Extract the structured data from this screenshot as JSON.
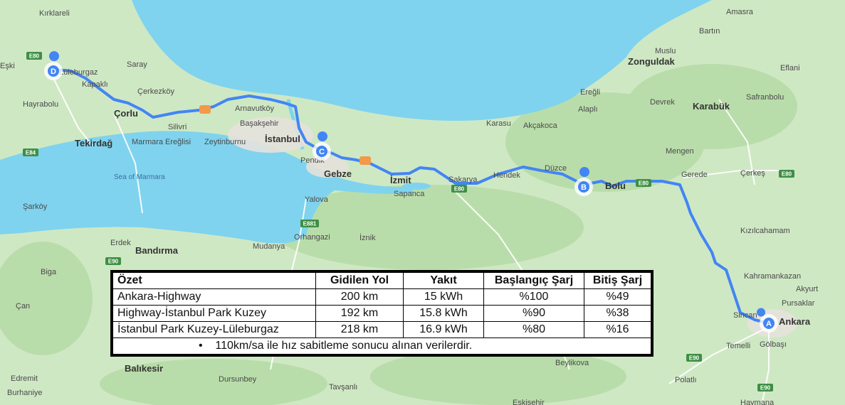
{
  "map": {
    "route_color": "#4285f4",
    "water_color": "#7fd3ee",
    "land_color": "#cfe8c4",
    "places": [
      "Kırklareli",
      "Lüleburgaz",
      "Kapaklı",
      "Çerkezköy",
      "Saray",
      "Hayrabolu",
      "Çorlu",
      "Silivri",
      "Tekirdağ",
      "Marmara Ereğlisi",
      "Arnavutköy",
      "Başakşehir",
      "İstanbul",
      "Zeytinburnu",
      "Pendik",
      "Gebze",
      "İzmit",
      "Sapanca",
      "Sakarya",
      "Hendek",
      "Düzce",
      "Bolu",
      "Akçakoca",
      "Karasu",
      "Ereğli",
      "Alaplı",
      "Zonguldak",
      "Devrek",
      "Karabük",
      "Safranbolu",
      "Eflani",
      "Bartın",
      "Amasra",
      "Muslu",
      "Gerede",
      "Çerkeş",
      "Mengen",
      "Kızılcahamam",
      "Kahramankazan",
      "Pursaklar",
      "Akyurt",
      "Sincan",
      "Ankara",
      "Gölbaşı",
      "Temelli",
      "Polatlı",
      "Yalova",
      "İznik",
      "Orhangazi",
      "Mudanya",
      "Bandırma",
      "Erdek",
      "Biga",
      "Çan",
      "Edremit",
      "Burhaniye",
      "Balıkesir",
      "Dursunbey",
      "Tavşanlı",
      "Beylikova",
      "Şarköy",
      "Eskişehir",
      "Eşki",
      "Haymana"
    ],
    "sea_label": "Sea of Marmara",
    "road_shields": [
      "E80",
      "E84",
      "E90",
      "E881",
      "E80",
      "E80",
      "E80",
      "E90",
      "E90"
    ],
    "pins": [
      {
        "letter": "A",
        "place": "Ankara"
      },
      {
        "letter": "B",
        "place": "Bolu"
      },
      {
        "letter": "C",
        "place": "İstanbul"
      },
      {
        "letter": "D",
        "place": "Lüleburgaz"
      }
    ]
  },
  "summary": {
    "headers": [
      "Özet",
      "Gidilen Yol",
      "Yakıt",
      "Başlangıç Şarj",
      "Bitiş Şarj"
    ],
    "rows": [
      [
        "Ankara-Highway",
        "200 km",
        "15 kWh",
        "%100",
        "%49"
      ],
      [
        "Highway-İstanbul Park Kuzey",
        "192 km",
        "15.8 kWh",
        "%90",
        "%38"
      ],
      [
        "İstanbul Park Kuzey-Lüleburgaz",
        "218 km",
        "16.9 kWh",
        "%80",
        "%16"
      ]
    ],
    "note_bullet": "•",
    "note": "110km/sa ile hız sabitleme sonucu alınan verilerdir."
  }
}
